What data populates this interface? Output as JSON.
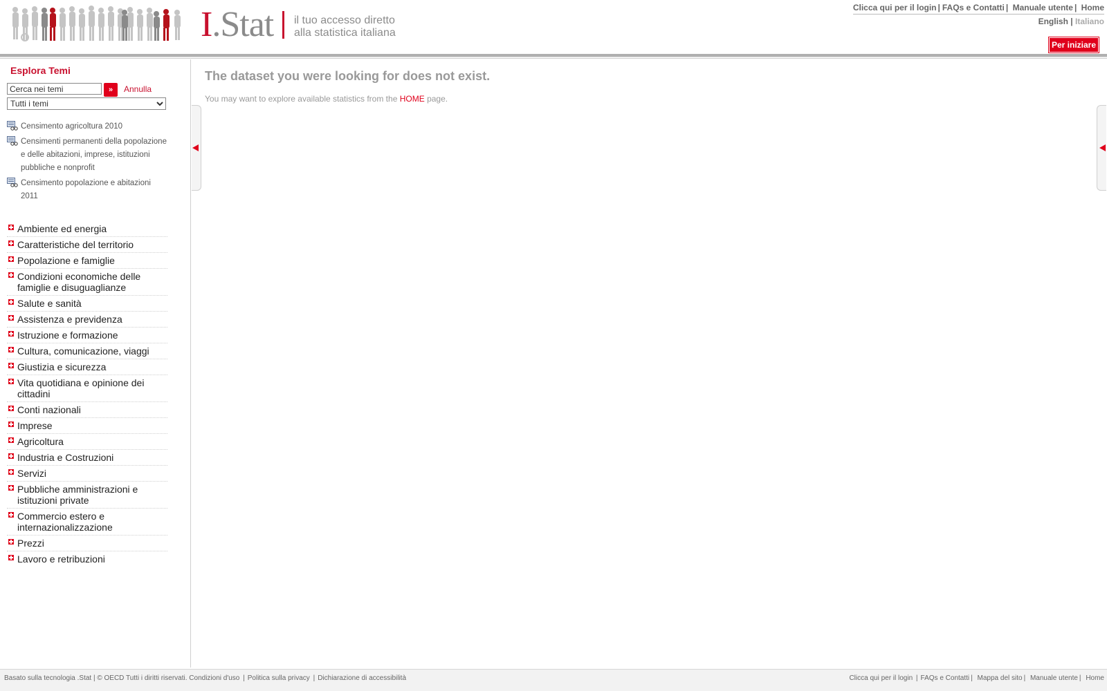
{
  "header": {
    "logo_text": "I.Stat",
    "logo_dot": "I",
    "logo_rest": ".Stat",
    "tagline_line1": "il tuo accesso diretto",
    "tagline_line2": "alla statistica italiana",
    "links": [
      "Clicca qui per il login",
      "FAQs e Contatti",
      "Manuale utente",
      "Home"
    ],
    "lang_english": "English",
    "lang_sep": "|",
    "lang_italiano": "Italiano",
    "start_button": "Per iniziare"
  },
  "sidebar": {
    "title": "Esplora Temi",
    "search_value": "Cerca nei temi",
    "search_go": "»",
    "cancel_label": "Annulla",
    "select_value": "Tutti i temi",
    "census": [
      "Censimento agricoltura 2010",
      "Censimenti permanenti della popolazione e delle abitazioni, imprese, istituzioni pubbliche e nonprofit",
      "Censimento popolazione e abitazioni 2011"
    ],
    "themes": [
      "Ambiente ed energia",
      "Caratteristiche del territorio",
      "Popolazione e famiglie",
      "Condizioni economiche delle famiglie e disuguaglianze",
      "Salute e sanità",
      "Assistenza e previdenza",
      "Istruzione e formazione",
      "Cultura, comunicazione, viaggi",
      "Giustizia e sicurezza",
      "Vita quotidiana e opinione dei cittadini",
      "Conti nazionali",
      "Imprese",
      "Agricoltura",
      "Industria e Costruzioni",
      "Servizi",
      "Pubbliche amministrazioni e istituzioni private",
      "Commercio estero e internazionalizzazione",
      "Prezzi",
      "Lavoro e retribuzioni"
    ]
  },
  "main": {
    "title": "The dataset you were looking for does not exist.",
    "message_before": "You may want to explore available statistics from the",
    "home_link": "HOME",
    "message_after": "page."
  },
  "footer": {
    "left_text": "Basato sulla tecnologia .Stat | © OECD Tutti i diritti riservati. Condizioni d'uso",
    "left_links": [
      "Politica sulla privacy",
      "Dichiarazione di accessibilità"
    ],
    "right_links": [
      "Clicca qui per il login",
      "FAQs e Contatti",
      "Mappa del sito",
      "Manuale utente",
      "Home"
    ]
  },
  "colors": {
    "accent_red": "#e0001b",
    "title_red": "#c8102e",
    "muted_gray": "#999999"
  }
}
